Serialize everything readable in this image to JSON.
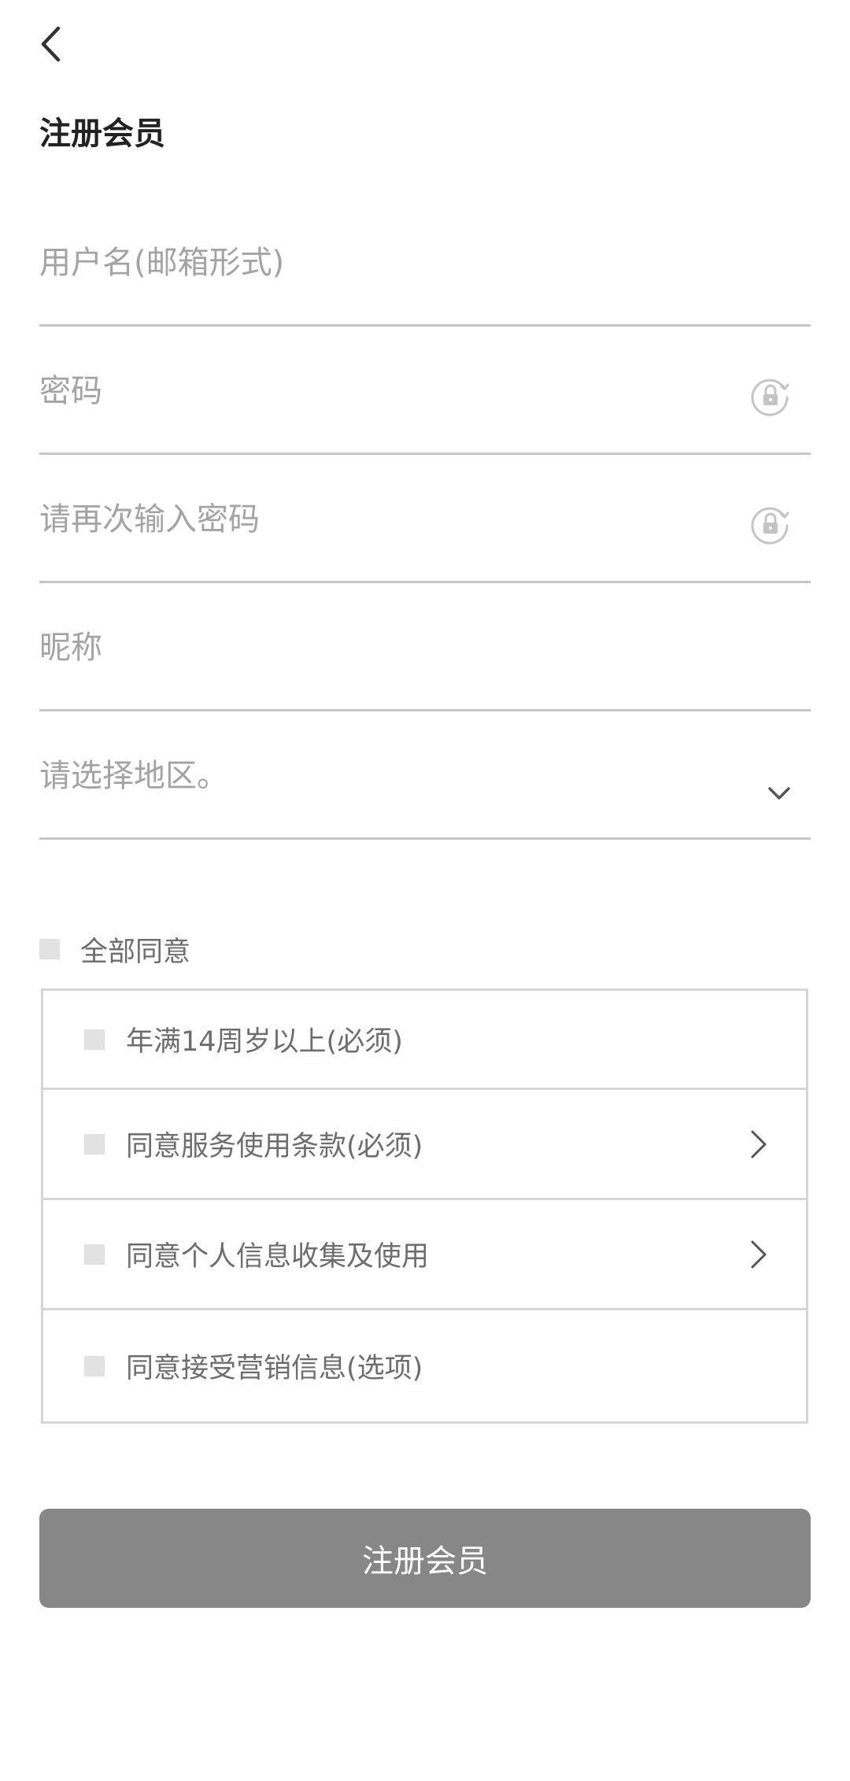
{
  "header": {
    "back_icon": "chevron-left-icon",
    "title": "注册会员"
  },
  "form": {
    "username": {
      "value": "",
      "placeholder": "用户名(邮箱形式)"
    },
    "password": {
      "value": "",
      "placeholder": "密码",
      "icon": "lock-icon"
    },
    "password_confirm": {
      "value": "",
      "placeholder": "请再次输入密码",
      "icon": "lock-icon"
    },
    "nickname": {
      "value": "",
      "placeholder": "昵称"
    },
    "region": {
      "selected": "请选择地区。",
      "icon": "chevron-down-icon"
    }
  },
  "agreements": {
    "all_label": "全部同意",
    "items": [
      {
        "label": "年满14周岁以上(必须)",
        "checked": false,
        "has_detail": false
      },
      {
        "label": "同意服务使用条款(必须)",
        "checked": false,
        "has_detail": true
      },
      {
        "label": "同意个人信息收集及使用",
        "checked": false,
        "has_detail": true
      },
      {
        "label": "同意接受营销信息(选项)",
        "checked": false,
        "has_detail": false
      }
    ]
  },
  "submit": {
    "label": "注册会员"
  },
  "colors": {
    "button_bg": "#878787",
    "placeholder": "#a3a3a3",
    "divider": "#c6c6c6",
    "checkbox": "#e2e2e2"
  }
}
